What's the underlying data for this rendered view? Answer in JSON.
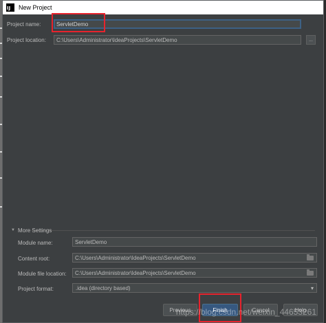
{
  "window": {
    "title": "New Project",
    "app_icon_text": "IJ"
  },
  "form": {
    "project_name_label": "Project name:",
    "project_name_value": "ServletDemo",
    "project_location_label": "Project location:",
    "project_location_value": "C:\\Users\\Administrator\\IdeaProjects\\ServletDemo",
    "browse_label": "..."
  },
  "more_settings": {
    "header": "More Settings",
    "toggle_glyph": "▼",
    "module_name_label": "Module name:",
    "module_name_value": "ServletDemo",
    "content_root_label": "Content root:",
    "content_root_value": "C:\\Users\\Administrator\\IdeaProjects\\ServletDemo",
    "module_file_location_label": "Module file location:",
    "module_file_location_value": "C:\\Users\\Administrator\\IdeaProjects\\ServletDemo",
    "project_format_label": "Project format:",
    "project_format_value": ".idea (directory based)",
    "dropdown_glyph": "▾"
  },
  "buttons": {
    "previous": "Previous",
    "finish": "Finish",
    "cancel": "Cancel",
    "help": "Help"
  },
  "watermark": "https://blog.csdn.net/weixin_44653261",
  "colors": {
    "background": "#3c3f41",
    "field": "#45494a",
    "primary_button": "#365880",
    "annotation": "#e8232d"
  }
}
